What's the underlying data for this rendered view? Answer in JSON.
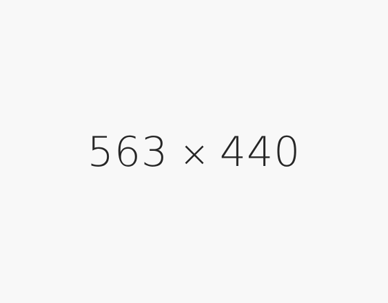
{
  "placeholder": {
    "width_text": "563",
    "separator": "×",
    "height_text": "440",
    "background_color": "#f8f8f8",
    "text_color": "#262626"
  }
}
